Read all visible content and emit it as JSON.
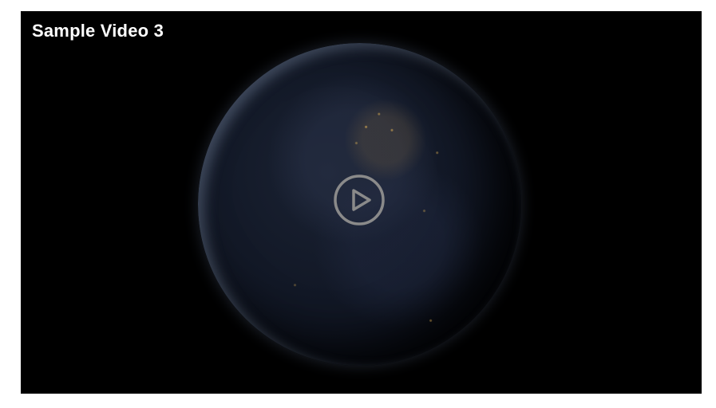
{
  "video": {
    "title": "Sample Video 3"
  },
  "icons": {
    "play": "play-icon"
  },
  "colors": {
    "frame_background": "#000000",
    "title_text": "#ffffff",
    "play_icon": "#8a8a8a"
  }
}
